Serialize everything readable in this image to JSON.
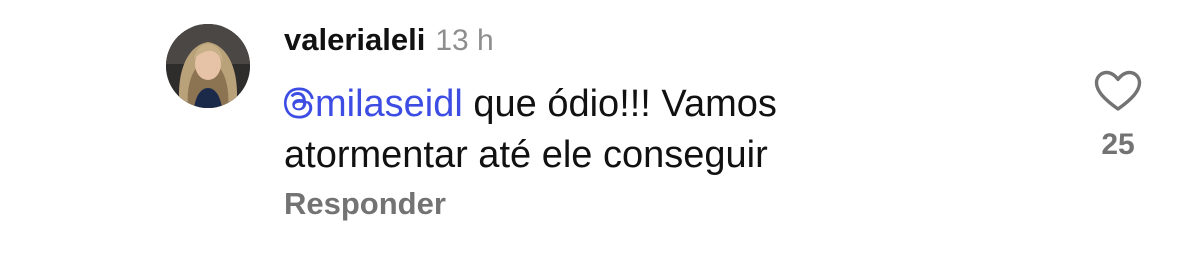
{
  "comment": {
    "username": "valerialeli",
    "timestamp": "13 h",
    "mention": "milaseidl",
    "mention_icon": "threads-at-icon",
    "text_line1": " que ódio!!! Vamos",
    "text_line2": "atormentar até ele conseguir",
    "reply_label": "Responder",
    "like_count": "25",
    "like_icon": "heart-outline-icon"
  },
  "colors": {
    "mention": "#3d4de3",
    "secondary_text": "#8e8e8e",
    "primary_text": "#111111"
  }
}
